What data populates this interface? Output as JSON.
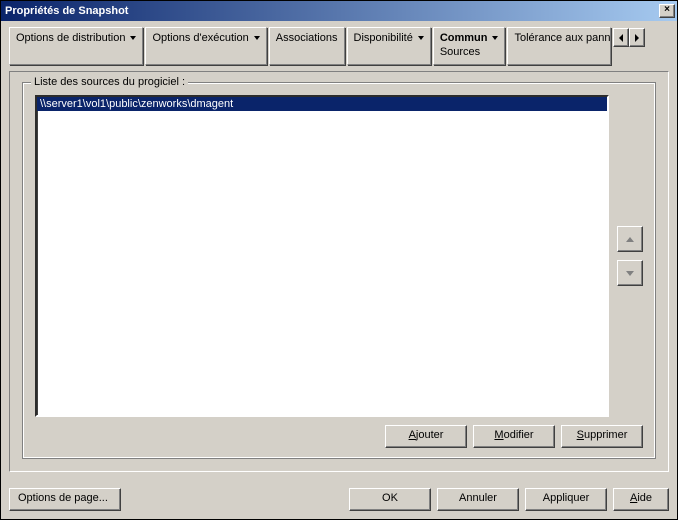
{
  "title": "Propriétés de Snapshot",
  "tabs": {
    "t0": {
      "label": "Options de distribution"
    },
    "t1": {
      "label": "Options d'exécution"
    },
    "t2": {
      "label": "Associations"
    },
    "t3": {
      "label": "Disponibilité"
    },
    "t4": {
      "label": "Commun",
      "sub": "Sources"
    },
    "t5": {
      "label": "Tolérance aux pannes"
    }
  },
  "group_label": "Liste des sources du progiciel :",
  "sources": [
    "\\\\server1\\vol1\\public\\zenworks\\dmagent"
  ],
  "buttons": {
    "add": "Ajouter",
    "modify": "Modifier",
    "remove": "Supprimer"
  },
  "footer": {
    "page_options": "Options de page",
    "ok": "OK",
    "cancel": "Annuler",
    "apply": "Appliquer",
    "help": "Aide"
  }
}
